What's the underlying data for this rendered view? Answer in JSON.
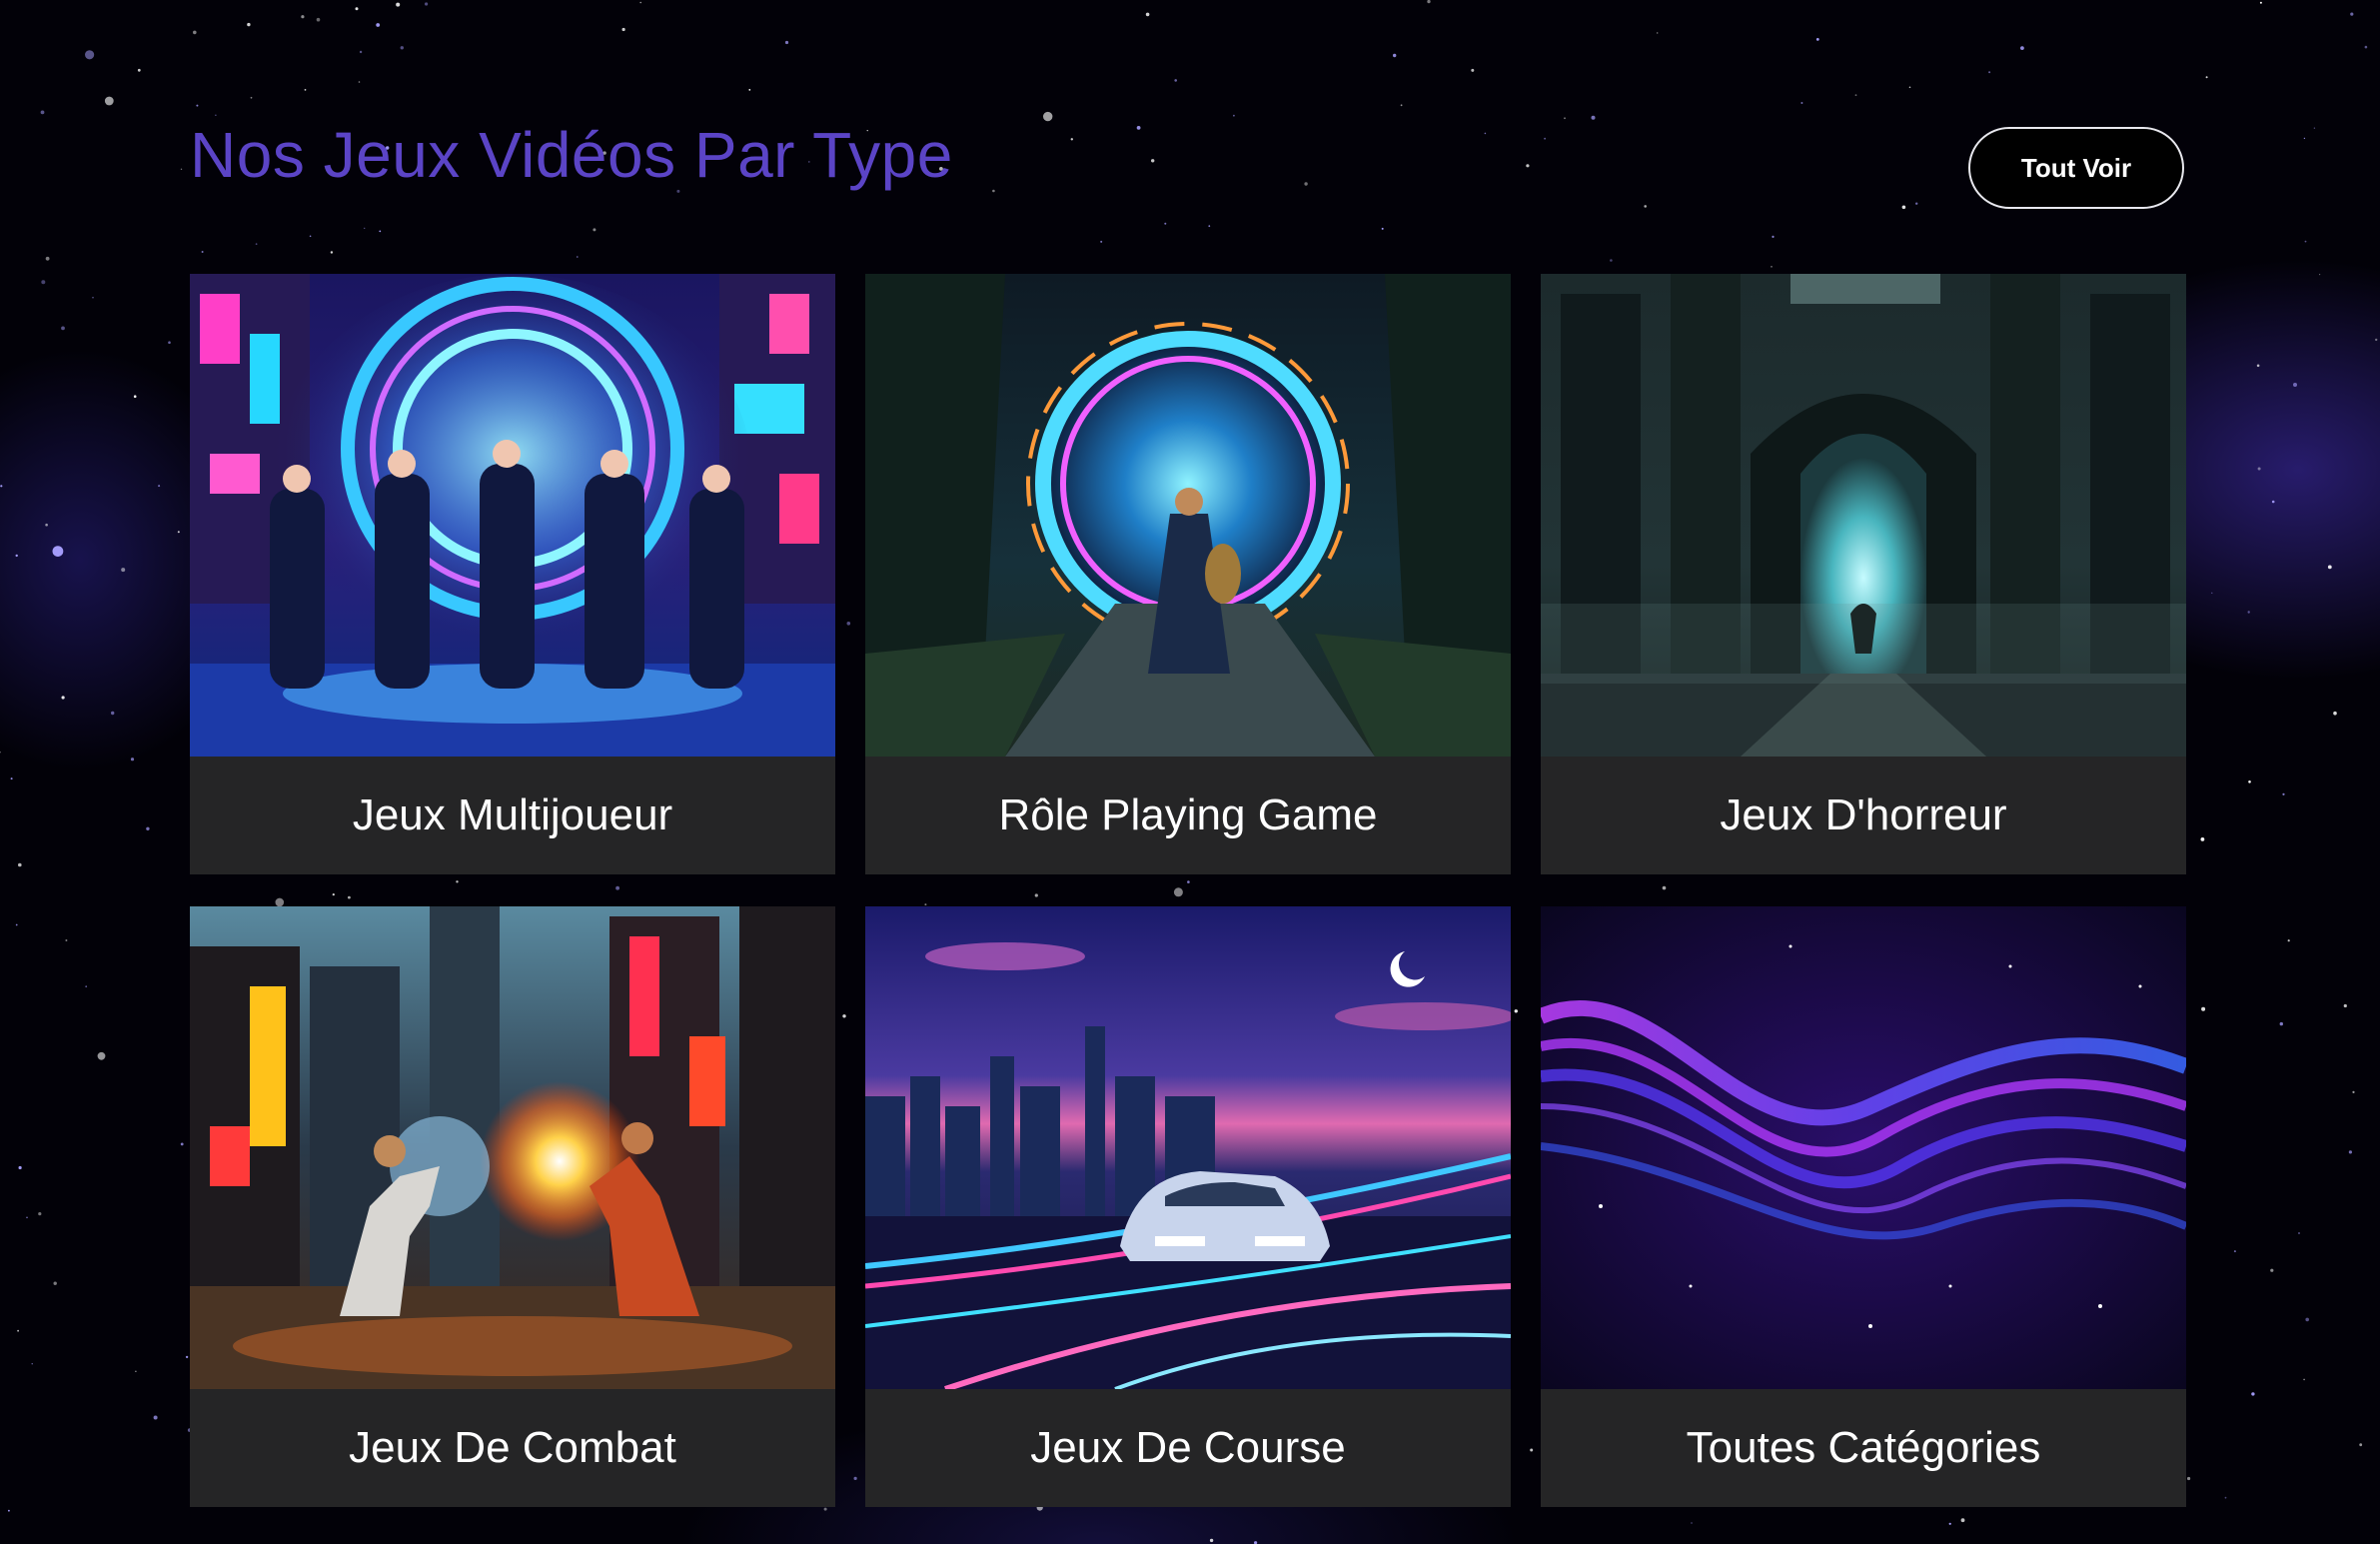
{
  "section": {
    "title": "Nos Jeux Vidéos Par Type",
    "see_all_label": "Tout Voir"
  },
  "cards": [
    {
      "label": "Jeux Multijoueur",
      "image": "neon-portal-squad"
    },
    {
      "label": "Rôle Playing Game",
      "image": "magic-portal-ruins"
    },
    {
      "label": "Jeux D'horreur",
      "image": "dark-cathedral-figure"
    },
    {
      "label": "Jeux De Combat",
      "image": "street-fighters-city"
    },
    {
      "label": "Jeux De Course",
      "image": "neon-night-racecar"
    },
    {
      "label": "Toutes Catégories",
      "image": "purple-wave-abstract"
    }
  ],
  "colors": {
    "background": "#020108",
    "title": "#5b44c6",
    "card_footer": "#252526",
    "button_border": "#e8e8ee"
  }
}
